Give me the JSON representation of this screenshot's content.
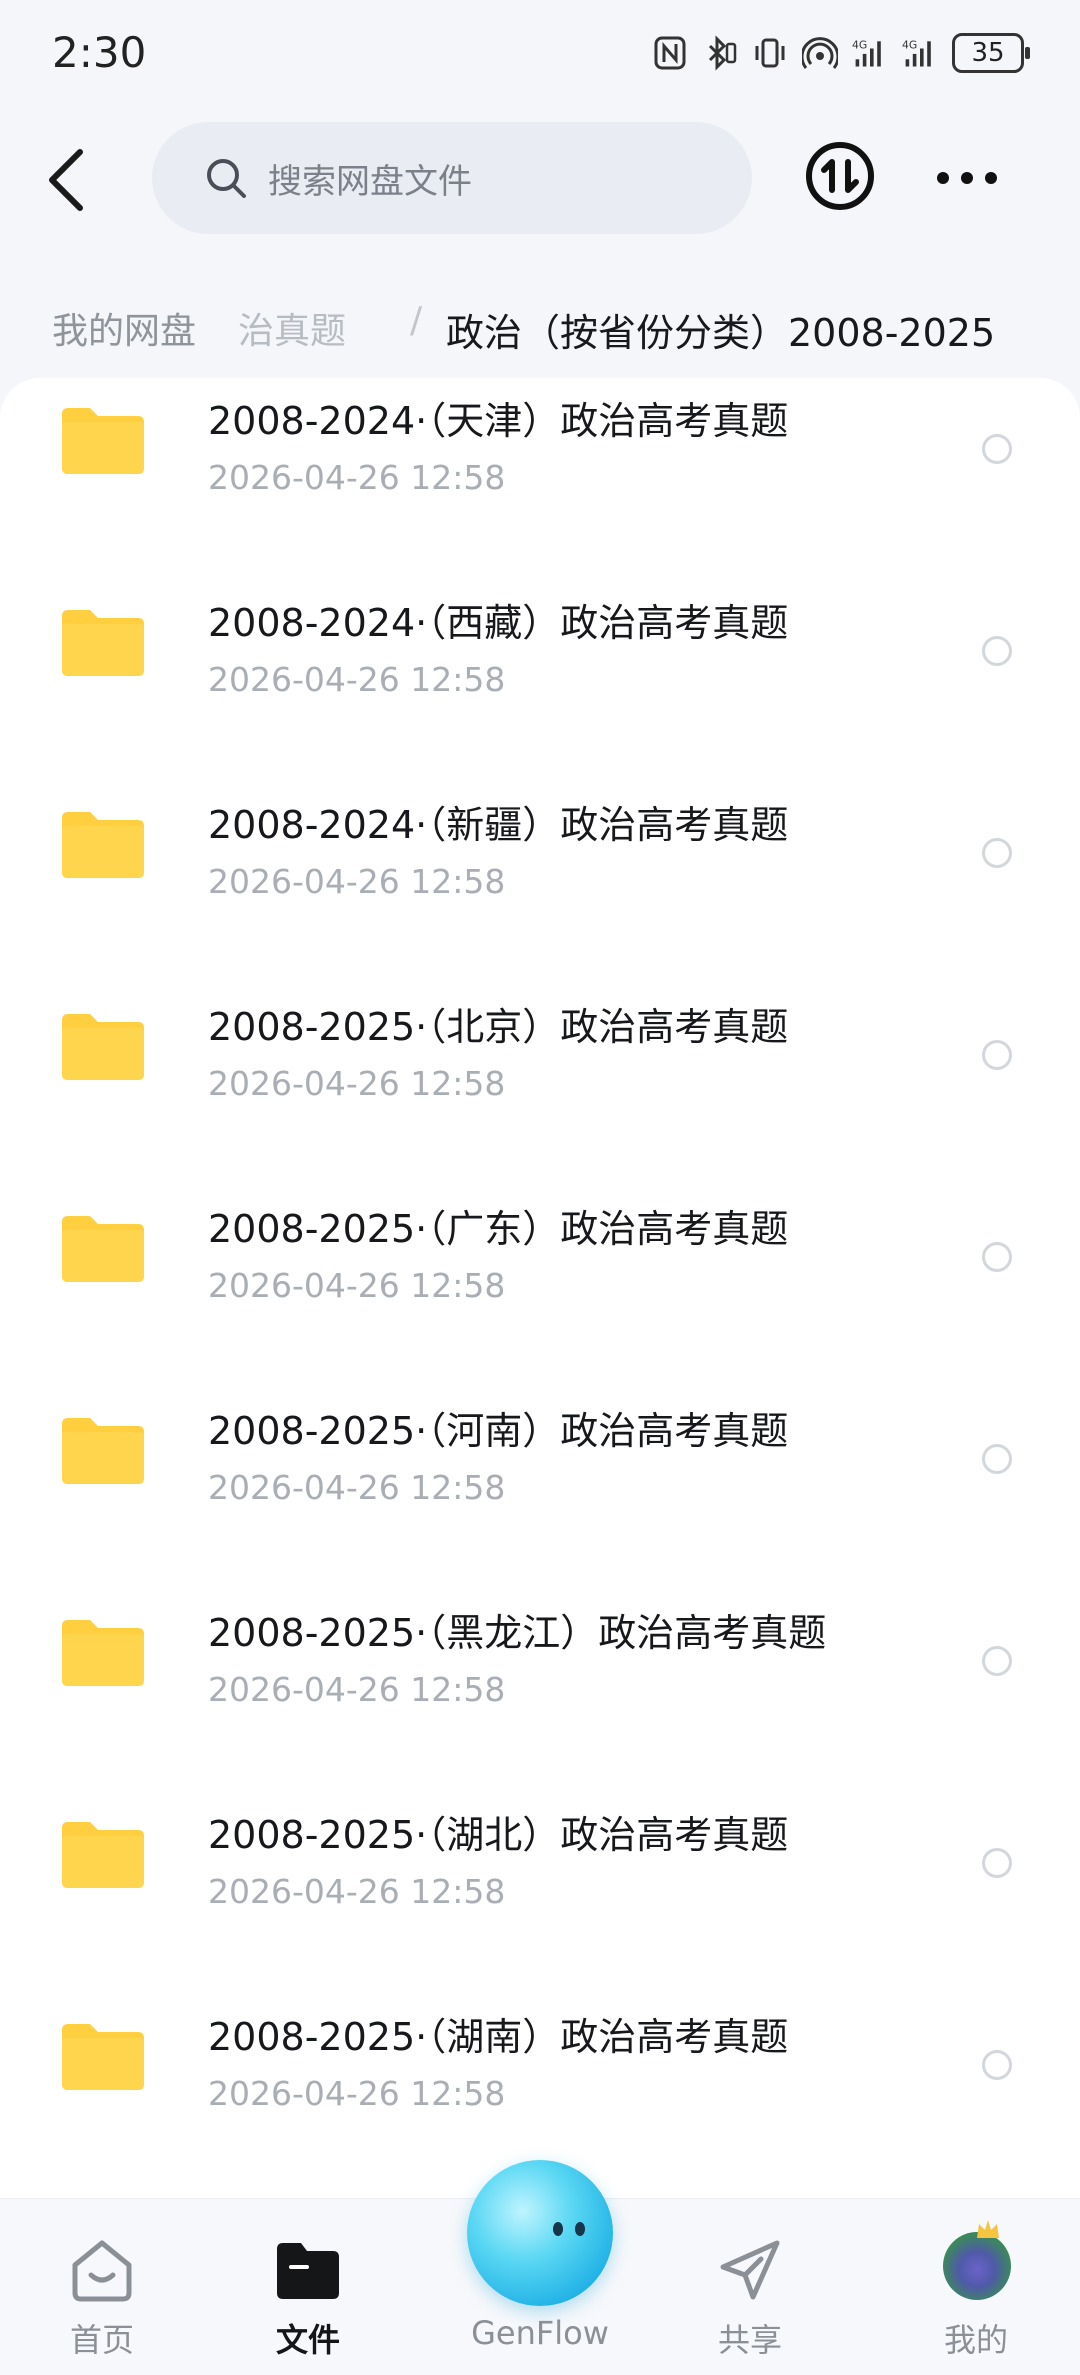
{
  "status_bar": {
    "time": "2:30",
    "battery": "35"
  },
  "search": {
    "placeholder": "搜索网盘文件"
  },
  "breadcrumb": {
    "root": "我的网盘",
    "middle": "治真题",
    "separator": "/",
    "current": "政治（按省份分类）2008-2025"
  },
  "files": [
    {
      "name": "2008-2024·（天津）政治高考真题",
      "date": "2026-04-26  12:58"
    },
    {
      "name": "2008-2024·（西藏）政治高考真题",
      "date": "2026-04-26  12:58"
    },
    {
      "name": "2008-2024·（新疆）政治高考真题",
      "date": "2026-04-26  12:58"
    },
    {
      "name": "2008-2025·（北京）政治高考真题",
      "date": "2026-04-26  12:58"
    },
    {
      "name": "2008-2025·（广东）政治高考真题",
      "date": "2026-04-26  12:58"
    },
    {
      "name": "2008-2025·（河南）政治高考真题",
      "date": "2026-04-26  12:58"
    },
    {
      "name": "2008-2025·（黑龙江）政治高考真题",
      "date": "2026-04-26  12:58"
    },
    {
      "name": "2008-2025·（湖北）政治高考真题",
      "date": "2026-04-26  12:58"
    },
    {
      "name": "2008-2025·（湖南）政治高考真题",
      "date": "2026-04-26  12:58"
    }
  ],
  "nav": {
    "home": "首页",
    "files": "文件",
    "genflow": "GenFlow",
    "share": "共享",
    "me": "我的"
  },
  "colors": {
    "folder": "#ffcf3f",
    "accent": "#1a93cf"
  }
}
